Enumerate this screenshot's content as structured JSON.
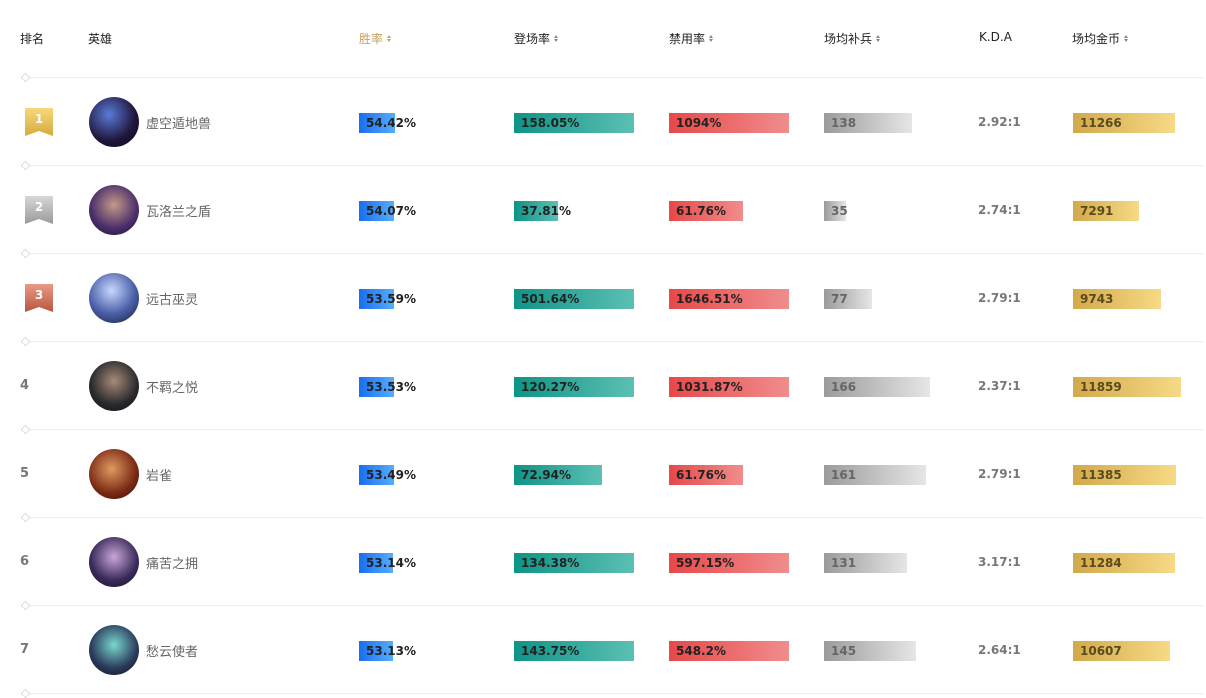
{
  "header": {
    "rank": "排名",
    "hero": "英雄",
    "win_rate": "胜率",
    "pick_rate": "登场率",
    "ban_rate": "禁用率",
    "avg_cs": "场均补兵",
    "kda": "K.D.A",
    "avg_gold": "场均金币"
  },
  "colors": {
    "active_header": "#c8a25a",
    "win_bar": "#1a6ef0",
    "pick_bar": "#0e9486",
    "ban_bar": "#e84848",
    "cs_bar": "#9b9b9b",
    "gold_bar": "#d3a94a"
  },
  "rows": [
    {
      "rank": "1",
      "badge": "gold",
      "name": "虚空遁地兽",
      "win": "54.42%",
      "win_frac": 0.54,
      "pick": "158.05%",
      "pick_frac": 1.0,
      "ban": "1094%",
      "ban_frac": 1.0,
      "cs": "138",
      "cs_frac": 0.73,
      "kda": "2.92:1",
      "gold": "11266",
      "gold_frac": 0.93
    },
    {
      "rank": "2",
      "badge": "silver",
      "name": "瓦洛兰之盾",
      "win": "54.07%",
      "win_frac": 0.53,
      "pick": "37.81%",
      "pick_frac": 0.37,
      "ban": "61.76%",
      "ban_frac": 0.62,
      "cs": "35",
      "cs_frac": 0.18,
      "kda": "2.74:1",
      "gold": "7291",
      "gold_frac": 0.6
    },
    {
      "rank": "3",
      "badge": "bronze",
      "name": "远古巫灵",
      "win": "53.59%",
      "win_frac": 0.53,
      "pick": "501.64%",
      "pick_frac": 1.0,
      "ban": "1646.51%",
      "ban_frac": 1.0,
      "cs": "77",
      "cs_frac": 0.4,
      "kda": "2.79:1",
      "gold": "9743",
      "gold_frac": 0.8
    },
    {
      "rank": "4",
      "badge": "",
      "name": "不羁之悦",
      "win": "53.53%",
      "win_frac": 0.53,
      "pick": "120.27%",
      "pick_frac": 1.0,
      "ban": "1031.87%",
      "ban_frac": 1.0,
      "cs": "166",
      "cs_frac": 0.88,
      "kda": "2.37:1",
      "gold": "11859",
      "gold_frac": 0.98
    },
    {
      "rank": "5",
      "badge": "",
      "name": "岩雀",
      "win": "53.49%",
      "win_frac": 0.53,
      "pick": "72.94%",
      "pick_frac": 0.73,
      "ban": "61.76%",
      "ban_frac": 0.62,
      "cs": "161",
      "cs_frac": 0.85,
      "kda": "2.79:1",
      "gold": "11385",
      "gold_frac": 0.94
    },
    {
      "rank": "6",
      "badge": "",
      "name": "痛苦之拥",
      "win": "53.14%",
      "win_frac": 0.52,
      "pick": "134.38%",
      "pick_frac": 1.0,
      "ban": "597.15%",
      "ban_frac": 1.0,
      "cs": "131",
      "cs_frac": 0.69,
      "kda": "3.17:1",
      "gold": "11284",
      "gold_frac": 0.93
    },
    {
      "rank": "7",
      "badge": "",
      "name": "愁云使者",
      "win": "53.13%",
      "win_frac": 0.52,
      "pick": "143.75%",
      "pick_frac": 1.0,
      "ban": "548.2%",
      "ban_frac": 1.0,
      "cs": "145",
      "cs_frac": 0.77,
      "kda": "2.64:1",
      "gold": "10607",
      "gold_frac": 0.88
    }
  ]
}
